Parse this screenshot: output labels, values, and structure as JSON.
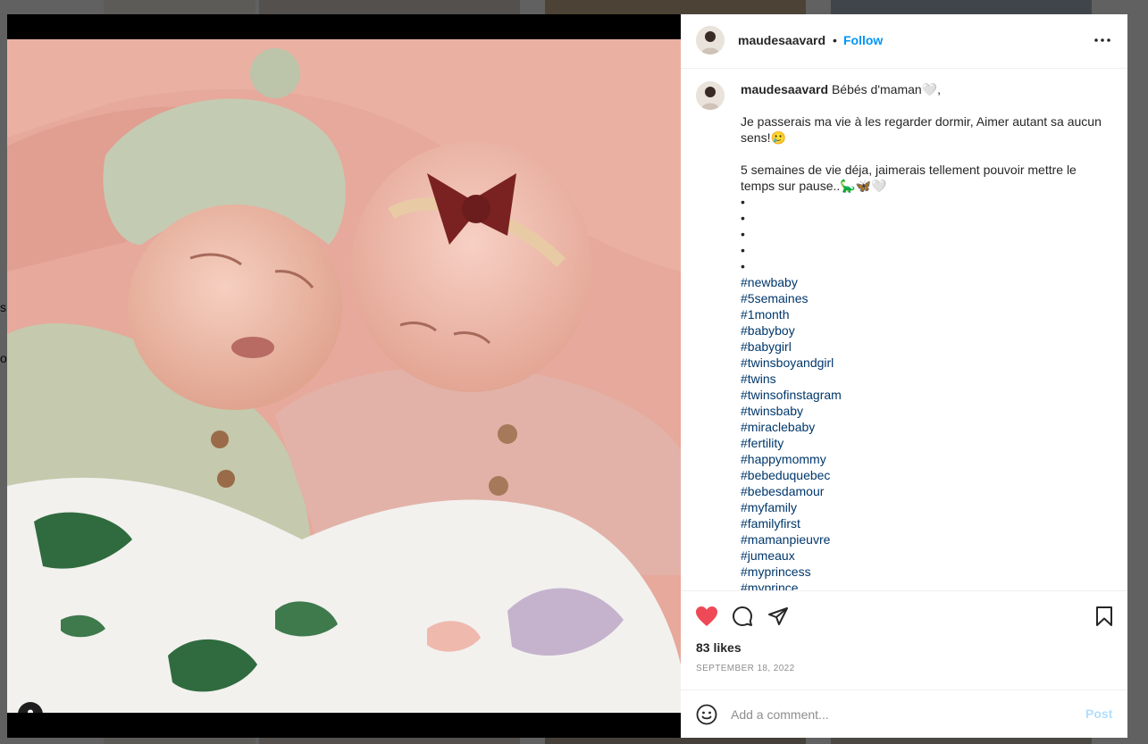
{
  "background": {
    "fragments": [
      "s.",
      "o"
    ]
  },
  "post": {
    "username": "maudesaavard",
    "follow_label": "Follow",
    "separator": "•",
    "caption": {
      "title": "Bébés d'maman🤍,",
      "line1": "Je passerais ma vie à les regarder dormir, Aimer autant sa aucun sens!🥲",
      "line2": "5 semaines de vie déja, jaimerais tellement pouvoir mettre le temps sur pause..🦕🦋🤍",
      "dots": [
        "•",
        "•",
        "•",
        "•",
        "•"
      ],
      "hashtags": [
        "#newbaby",
        "#5semaines",
        "#1month",
        "#babyboy",
        "#babygirl",
        "#twinsboyandgirl",
        "#twins",
        "#twinsofinstagram",
        "#twinsbaby",
        "#miraclebaby",
        "#fertility",
        "#happymommy",
        "#bebeduquebec",
        "#bebesdamour",
        "#myfamily",
        "#familyfirst",
        "#mamanpieuvre",
        "#jumeaux",
        "#myprincess",
        "#myprince"
      ]
    },
    "likes": "83 likes",
    "date": "SEPTEMBER 18, 2022",
    "comment_placeholder": "Add a comment...",
    "post_label": "Post"
  },
  "icons": {
    "like": "heart-filled-icon",
    "comment": "comment-icon",
    "share": "send-icon",
    "save": "bookmark-icon",
    "emoji": "emoji-icon",
    "more": "more-options-icon",
    "tag": "user-tag-icon"
  },
  "colors": {
    "like_red": "#ed4956",
    "follow_blue": "#0095f6",
    "hashtag_blue": "#00376b",
    "post_disabled": "#b2dffc"
  }
}
